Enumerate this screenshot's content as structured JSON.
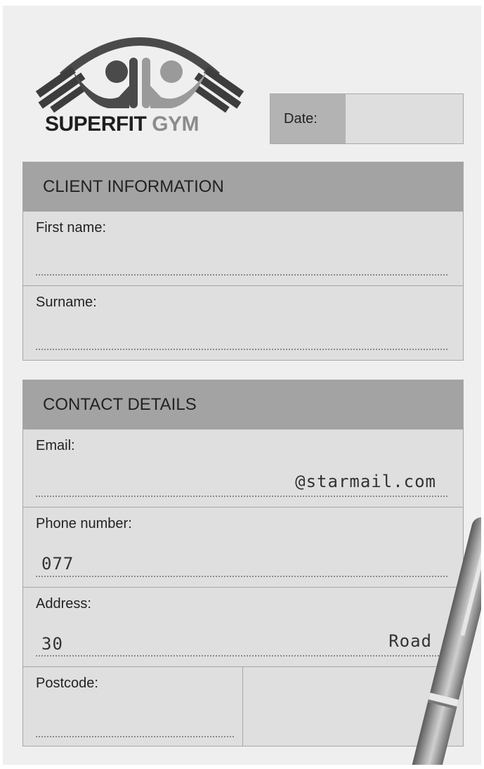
{
  "brand": {
    "name_dark": "SUPERFIT",
    "name_light": "GYM"
  },
  "date": {
    "label": "Date:",
    "value": ""
  },
  "client": {
    "title": "CLIENT INFORMATION",
    "fields": [
      {
        "label": "First name:",
        "value": ""
      },
      {
        "label": "Surname:",
        "value": ""
      }
    ]
  },
  "contact": {
    "title": "CONTACT DETAILS",
    "email": {
      "label": "Email:",
      "value": "@starmail.com"
    },
    "phone": {
      "label": "Phone number:",
      "value": "077"
    },
    "address": {
      "label": "Address:",
      "value_start": "30",
      "value_end": "Road"
    },
    "postcode": {
      "label": "Postcode:",
      "value": ""
    }
  },
  "colors": {
    "header": "#a3a3a3",
    "field_bg": "#dfdfdf",
    "paper": "#efefef"
  },
  "icons": [
    "gym-logo-icon",
    "pen-icon"
  ]
}
